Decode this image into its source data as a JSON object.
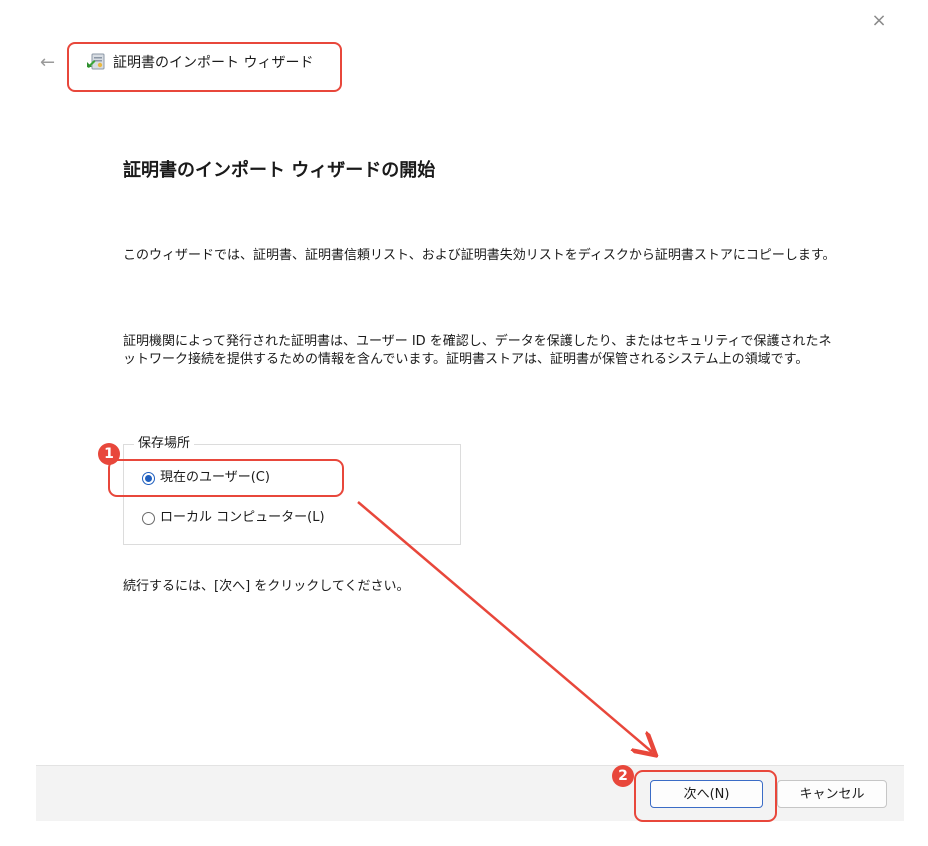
{
  "window": {
    "title": "証明書のインポート ウィザード",
    "close_glyph": "×",
    "back_glyph": "←",
    "title_icon": "certificate-import-icon",
    "close_icon": "close-icon",
    "back_icon": "back-arrow-icon"
  },
  "main": {
    "heading": "証明書のインポート ウィザードの開始",
    "paragraph1": "このウィザードでは、証明書、証明書信頼リスト、および証明書失効リストをディスクから証明書ストアにコピーします。",
    "paragraph2": "証明機関によって発行された証明書は、ユーザー ID を確認し、データを保護したり、またはセキュリティで保護されたネットワーク接続を提供するための情報を含んでいます。証明書ストアは、証明書が保管されるシステム上の領域です。",
    "store_location": {
      "legend": "保存場所",
      "options": [
        {
          "label": "現在のユーザー(C)",
          "selected": true
        },
        {
          "label": "ローカル コンピューター(L)",
          "selected": false
        }
      ]
    },
    "continue_text": "続行するには、[次へ] をクリックしてください。"
  },
  "footer": {
    "next_label": "次へ(N)",
    "cancel_label": "キャンセル"
  },
  "annotations": {
    "badge1": "1",
    "badge2": "2",
    "accent_color": "#e8473b"
  }
}
